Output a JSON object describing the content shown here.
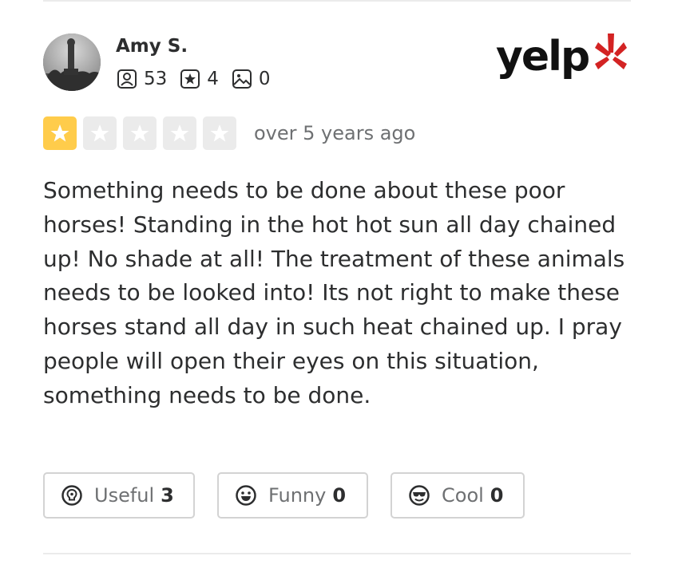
{
  "review": {
    "user": {
      "name": "Amy S.",
      "friends_count": "53",
      "reviews_count": "4",
      "photos_count": "0"
    },
    "brand": {
      "logo_text": "yelp",
      "accent_color": "#d32323"
    },
    "rating": {
      "value": 1,
      "max": 5,
      "filled_color": "#ffcc4b",
      "empty_color": "#ebebeb"
    },
    "timestamp": "over 5 years ago",
    "text": "Something needs to be done about these poor horses! Standing in the hot hot sun all day chained up! No shade at all! The treatment of these animals needs to be looked into! Its not right to make these horses stand all day in such heat chained up. I pray people will open their eyes on this situation, something needs to be done.",
    "reactions": {
      "useful": {
        "label": "Useful",
        "count": "3",
        "icon": "lightbulb-icon"
      },
      "funny": {
        "label": "Funny",
        "count": "0",
        "icon": "smile-icon"
      },
      "cool": {
        "label": "Cool",
        "count": "0",
        "icon": "sunglasses-icon"
      }
    }
  }
}
